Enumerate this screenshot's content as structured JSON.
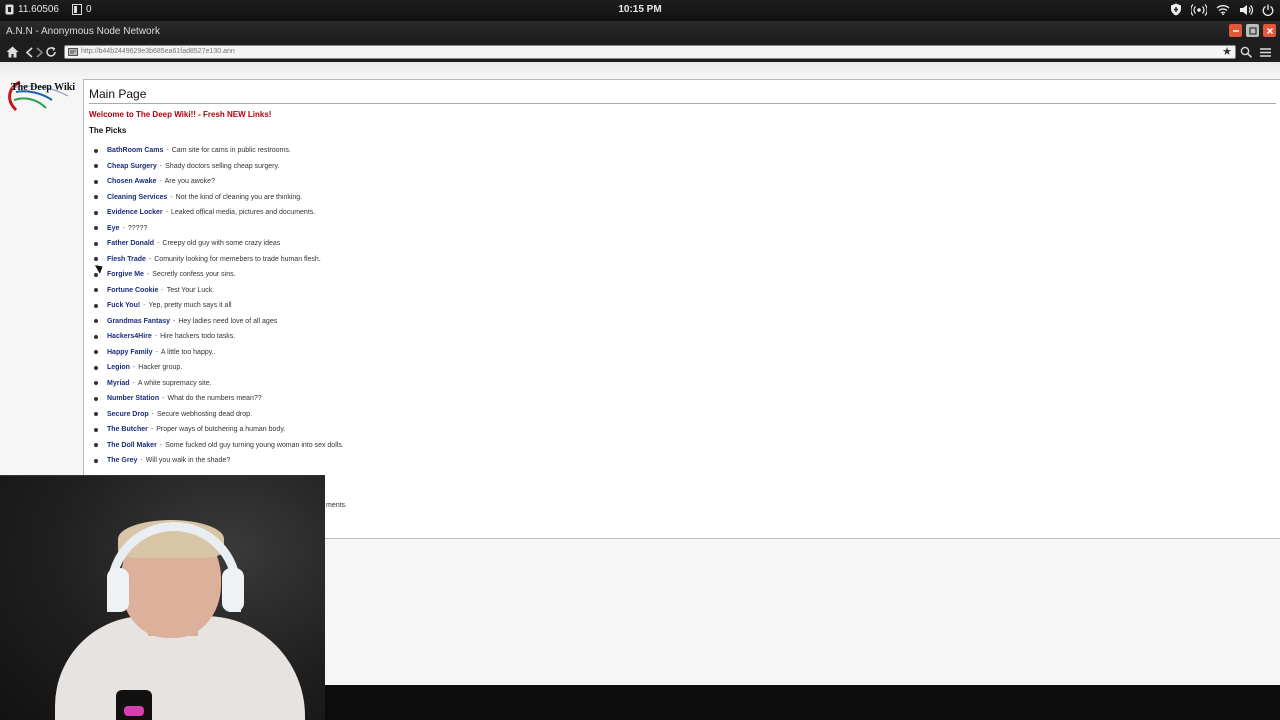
{
  "system": {
    "left_value": "11.60506",
    "doc_count": "0",
    "clock": "10:15 PM"
  },
  "window": {
    "title": "A.N.N - Anonymous Node Network"
  },
  "nav": {
    "url": "http://b44b2449629e3b685ea61fad8527e130.ann"
  },
  "page": {
    "logo_text": "The Deep Wiki",
    "heading": "Main Page",
    "welcome": "Welcome to The Deep Wiki!! - Fresh NEW Links!",
    "picks_heading": "The Picks",
    "links": [
      {
        "name": "BathRoom Cams",
        "desc": "Cam site for cams in public restrooms."
      },
      {
        "name": "Cheap Surgery",
        "desc": "Shady doctors selling cheap surgery."
      },
      {
        "name": "Chosen Awake",
        "desc": "Are you awoke?"
      },
      {
        "name": "Cleaning Services",
        "desc": "Not the kind of cleaning you are thinking."
      },
      {
        "name": "Evidence Locker",
        "desc": "Leaked offical media, pictures and documents."
      },
      {
        "name": "Eye",
        "desc": "?????"
      },
      {
        "name": "Father Donald",
        "desc": "Creepy old guy with some crazy ideas"
      },
      {
        "name": "Flesh Trade",
        "desc": "Comunity looking for memebers to trade human flesh."
      },
      {
        "name": "Forgive Me",
        "desc": "Secretly confess your sins."
      },
      {
        "name": "Fortune Cookie",
        "desc": "Test Your Luck."
      },
      {
        "name": "Fuck You!",
        "desc": "Yep, pretty much says it all"
      },
      {
        "name": "Grandmas Fantasy",
        "desc": "Hey ladies need love of all ages"
      },
      {
        "name": "Hackers4Hire",
        "desc": "Hire hackers todo tasks."
      },
      {
        "name": "Happy Family",
        "desc": "A little too happy.."
      },
      {
        "name": "Legion",
        "desc": "Hacker group."
      },
      {
        "name": "Myriad",
        "desc": "A white supremacy site."
      },
      {
        "name": "Number Station",
        "desc": "What do the numbers mean??"
      },
      {
        "name": "Secure Drop",
        "desc": "Secure webhosting dead drop."
      },
      {
        "name": "The Butcher",
        "desc": "Proper ways of butchering a human body."
      },
      {
        "name": "The Doll Maker",
        "desc": "Some fucked old guy turning young woman into sex dolls."
      },
      {
        "name": "The Grey",
        "desc": "Will you walk in the shade?"
      }
    ],
    "partial_text": "ments."
  },
  "colors": {
    "link": "#1b2c7a",
    "welcome": "#b3000c",
    "accent_button": "#e2563a"
  }
}
